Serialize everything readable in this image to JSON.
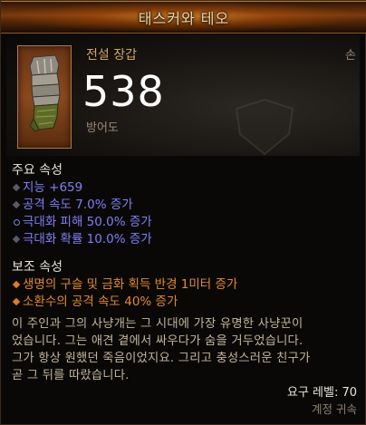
{
  "item": {
    "name": "태스커와 테오",
    "type": "전설 장갑",
    "slot": "손",
    "armor_value": "538",
    "armor_label": "방어도",
    "icon": "legendary-gauntlet-icon"
  },
  "primary": {
    "title": "주요 속성",
    "stats": [
      "지능 +659",
      "공격 속도 7.0% 증가",
      "극대화 피해 50.0% 증가",
      "극대화 확률 10.0% 증가"
    ]
  },
  "secondary": {
    "title": "보조 속성",
    "stats": [
      "생명의 구슬 및 금화 획득 반경 1미터 증가",
      "소환수의 공격 속도 40% 증가"
    ]
  },
  "flavor_lines": [
    "이 주인과 그의 사냥개는 그 시대에 가장 유명한 사냥꾼이",
    "었습니다. 그는 애견 곁에서 싸우다가 숨을 거두었습니다.",
    "그가 항상 원했던 죽음이었지요. 그리고 충성스러운 친구가",
    "곧 그 뒤를 따랐습니다."
  ],
  "requirement": "요구 레벨: 70",
  "binding": "계정 귀속",
  "colors": {
    "legendary": "#d0a468",
    "magic_blue": "#7f7ff5",
    "affix_orange": "#e08a30",
    "flavor": "#c2b59a"
  }
}
